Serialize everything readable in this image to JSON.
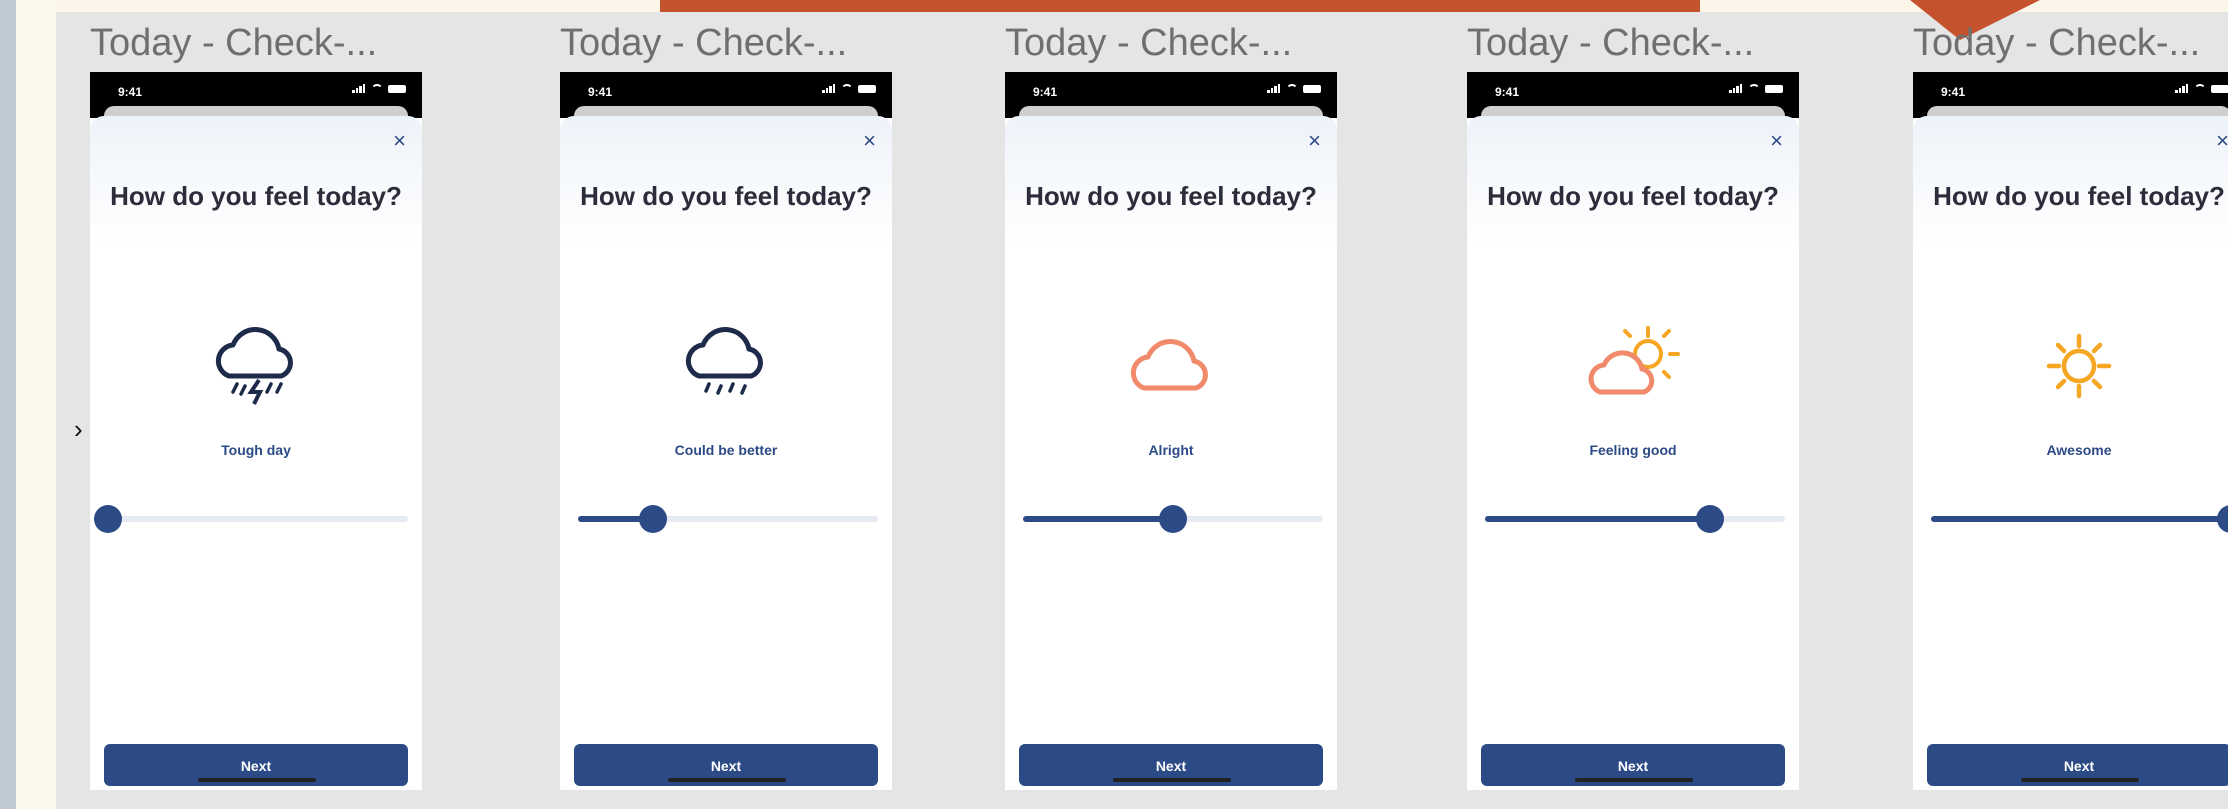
{
  "canvas": {
    "expand_icon": "chevron-right-icon"
  },
  "artboards": [
    {
      "title": "Today - Check-...",
      "status_time": "9:41",
      "question": "How do you feel today?",
      "mood": "Tough day",
      "icon": "storm-cloud-icon",
      "slider": 0.0,
      "next_label": "Next"
    },
    {
      "title": "Today - Check-...",
      "status_time": "9:41",
      "question": "How do you feel today?",
      "mood": "Could be better",
      "icon": "rain-cloud-icon",
      "slider": 0.25,
      "next_label": "Next"
    },
    {
      "title": "Today - Check-...",
      "status_time": "9:41",
      "question": "How do you feel today?",
      "mood": "Alright",
      "icon": "cloud-icon",
      "slider": 0.5,
      "next_label": "Next"
    },
    {
      "title": "Today - Check-...",
      "status_time": "9:41",
      "question": "How do you feel today?",
      "mood": "Feeling good",
      "icon": "partly-sunny-icon",
      "slider": 0.75,
      "next_label": "Next"
    },
    {
      "title": "Today - Check-...",
      "status_time": "9:41",
      "question": "How do you feel today?",
      "mood": "Awesome",
      "icon": "sun-icon",
      "slider": 1.0,
      "next_label": "Next"
    }
  ],
  "colors": {
    "primary": "#2b4a86",
    "cloud_orange": "#f08a6a",
    "sun_orange": "#f5a623",
    "banner": "#c4532d"
  }
}
